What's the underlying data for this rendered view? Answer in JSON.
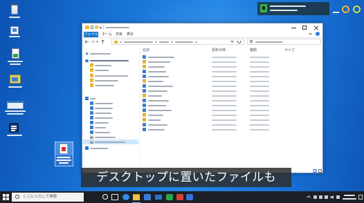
{
  "subtitle": {
    "text": "デスクトップに置いたファイルも"
  },
  "explorer": {
    "ribbon_tabs": [
      {
        "label": "ファイル",
        "active": true
      },
      {
        "label": "ホーム"
      },
      {
        "label": "共有"
      },
      {
        "label": "表示"
      }
    ],
    "columns": {
      "name": "名前",
      "modified": "更新日時",
      "type": "種類",
      "size": "サイズ"
    },
    "nav_items": [
      {
        "icon": "quick-access-star-icon"
      },
      {
        "icon": "onedrive-cloud-icon",
        "bold": true
      },
      {
        "icon": "folder-icon"
      },
      {
        "icon": "folder-icon"
      },
      {
        "icon": "folder-icon"
      },
      {
        "icon": "folder-icon"
      },
      {
        "icon": "folder-icon"
      },
      {
        "icon": "pc-icon"
      },
      {
        "icon": "library-folder-icon"
      },
      {
        "icon": "library-folder-icon"
      },
      {
        "icon": "library-folder-icon"
      },
      {
        "icon": "library-folder-icon"
      },
      {
        "icon": "library-folder-icon"
      },
      {
        "icon": "library-folder-icon"
      },
      {
        "icon": "library-folder-icon"
      },
      {
        "icon": "drive-icon"
      },
      {
        "icon": "drive-icon",
        "selected": true
      },
      {
        "icon": "network-icon"
      }
    ],
    "file_rows": [
      {
        "icon": "library-folder-icon"
      },
      {
        "icon": "folder-icon"
      },
      {
        "icon": "folder-icon"
      },
      {
        "icon": "library-folder-icon"
      },
      {
        "icon": "library-folder-icon"
      },
      {
        "icon": "folder-icon"
      },
      {
        "icon": "library-folder-icon"
      },
      {
        "icon": "library-folder-icon"
      },
      {
        "icon": "folder-icon"
      },
      {
        "icon": "library-folder-icon"
      },
      {
        "icon": "library-folder-icon"
      },
      {
        "icon": "library-folder-icon"
      },
      {
        "icon": "folder-icon"
      },
      {
        "icon": "folder-icon"
      },
      {
        "icon": "library-folder-icon"
      },
      {
        "icon": "library-folder-icon"
      }
    ]
  },
  "taskbar": {
    "search_placeholder": "ここに入力して検索",
    "apps": [
      {
        "icon": "cortana-icon"
      },
      {
        "icon": "task-view-icon"
      },
      {
        "icon": "edge-icon"
      },
      {
        "icon": "file-explorer-icon",
        "active": true
      },
      {
        "icon": "store-icon"
      },
      {
        "icon": "mail-icon"
      },
      {
        "icon": "green-app-icon"
      },
      {
        "icon": "red-app-icon"
      },
      {
        "icon": "blue-app-icon"
      }
    ]
  },
  "desktop": {
    "icons": [
      "recycle-bin-icon",
      "pc-icon",
      "spreadsheet-shortcut-icon",
      "app-shortcut-icon",
      "window-shortcut-icon",
      "app-shortcut-icon"
    ],
    "selected_file_icon": "pdf-file-icon"
  },
  "recorder_overlay": {
    "icons": [
      "record-icon",
      "minimize-icon",
      "orange-circle-icon",
      "lime-circle-icon"
    ]
  },
  "colors": {
    "accent": "#1979ca",
    "desktop": "#1a72d6",
    "taskbar": "#1c1f26",
    "subtitle_text": "#ffffff",
    "subtitle_background": "#2d2d2d",
    "selection": "#cce8ff"
  }
}
